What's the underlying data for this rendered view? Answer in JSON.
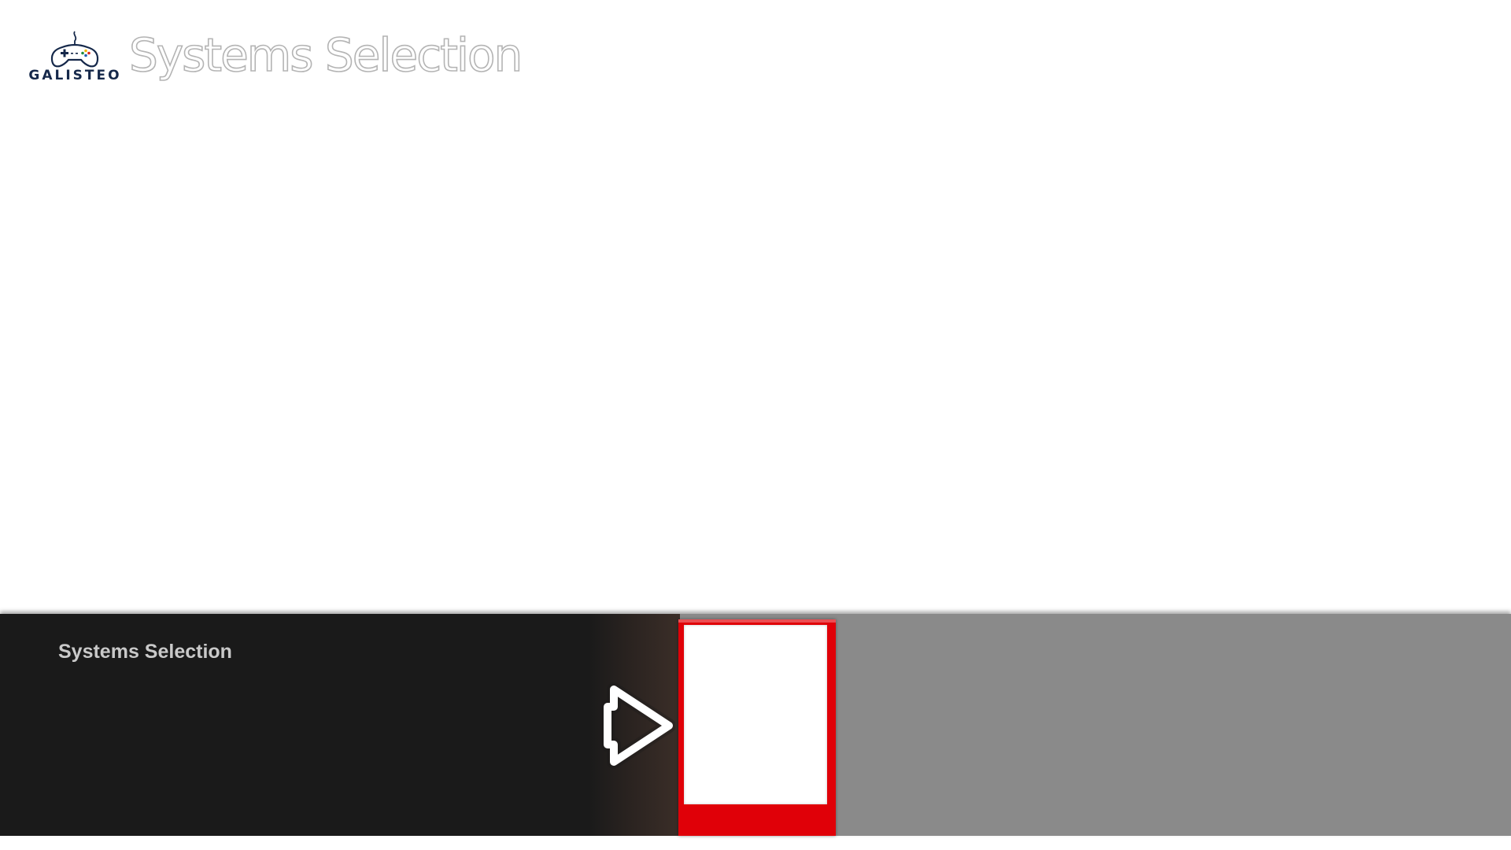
{
  "header": {
    "logo_text": "GALISTEO",
    "title": "Systems Selection"
  },
  "info_panel": {
    "title": "Systems Selection"
  },
  "carousel": {
    "arrow_icon": "arrow-right-icon",
    "selected_tile_color": "#e00008"
  }
}
